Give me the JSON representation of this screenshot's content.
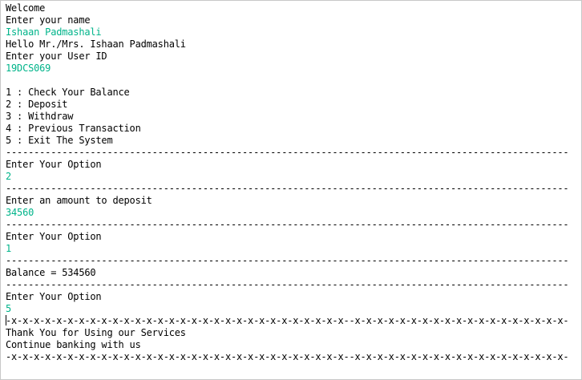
{
  "console": {
    "lines": [
      {
        "text": "Welcome",
        "kind": "out"
      },
      {
        "text": "Enter your name",
        "kind": "out"
      },
      {
        "text": "Ishaan Padmashali",
        "kind": "in"
      },
      {
        "text": "Hello Mr./Mrs. Ishaan Padmashali",
        "kind": "out"
      },
      {
        "text": "Enter your User ID",
        "kind": "out"
      },
      {
        "text": "19DCS069",
        "kind": "in"
      },
      {
        "text": "",
        "kind": "blank"
      },
      {
        "text": "1 : Check Your Balance",
        "kind": "out"
      },
      {
        "text": "2 : Deposit",
        "kind": "out"
      },
      {
        "text": "3 : Withdraw",
        "kind": "out"
      },
      {
        "text": "4 : Previous Transaction",
        "kind": "out"
      },
      {
        "text": "5 : Exit The System",
        "kind": "out"
      },
      {
        "text": "----------------------------------------------------------------------------------------------------",
        "kind": "out"
      },
      {
        "text": "Enter Your Option",
        "kind": "out"
      },
      {
        "text": "2",
        "kind": "in"
      },
      {
        "text": "----------------------------------------------------------------------------------------------------",
        "kind": "out"
      },
      {
        "text": "Enter an amount to deposit",
        "kind": "out"
      },
      {
        "text": "34560",
        "kind": "in"
      },
      {
        "text": "----------------------------------------------------------------------------------------------------",
        "kind": "out"
      },
      {
        "text": "Enter Your Option",
        "kind": "out"
      },
      {
        "text": "1",
        "kind": "in"
      },
      {
        "text": "----------------------------------------------------------------------------------------------------",
        "kind": "out"
      },
      {
        "text": "Balance = 534560",
        "kind": "out"
      },
      {
        "text": "----------------------------------------------------------------------------------------------------",
        "kind": "out"
      },
      {
        "text": "Enter Your Option",
        "kind": "out"
      },
      {
        "text": "5",
        "kind": "in"
      },
      {
        "text": "-x-x-x-x-x-x-x-x-x-x-x-x-x-x-x-x-x-x-x-x-x-x-x-x-x-x-x-x-x-x--x-x-x-x-x-x-x-x-x-x-x-x-x-x-x-x-x-x-x-",
        "kind": "out",
        "cursor": true
      },
      {
        "text": "Thank You for Using our Services",
        "kind": "out"
      },
      {
        "text": "Continue banking with us",
        "kind": "out"
      },
      {
        "text": "-x-x-x-x-x-x-x-x-x-x-x-x-x-x-x-x-x-x-x-x-x-x-x-x-x-x-x-x-x-x--x-x-x-x-x-x-x-x-x-x-x-x-x-x-x-x-x-x-x-",
        "kind": "out"
      }
    ]
  },
  "colors": {
    "output_text": "#000000",
    "user_input_text": "#00b48a",
    "background": "#ffffff",
    "border": "#c8c8c8"
  }
}
